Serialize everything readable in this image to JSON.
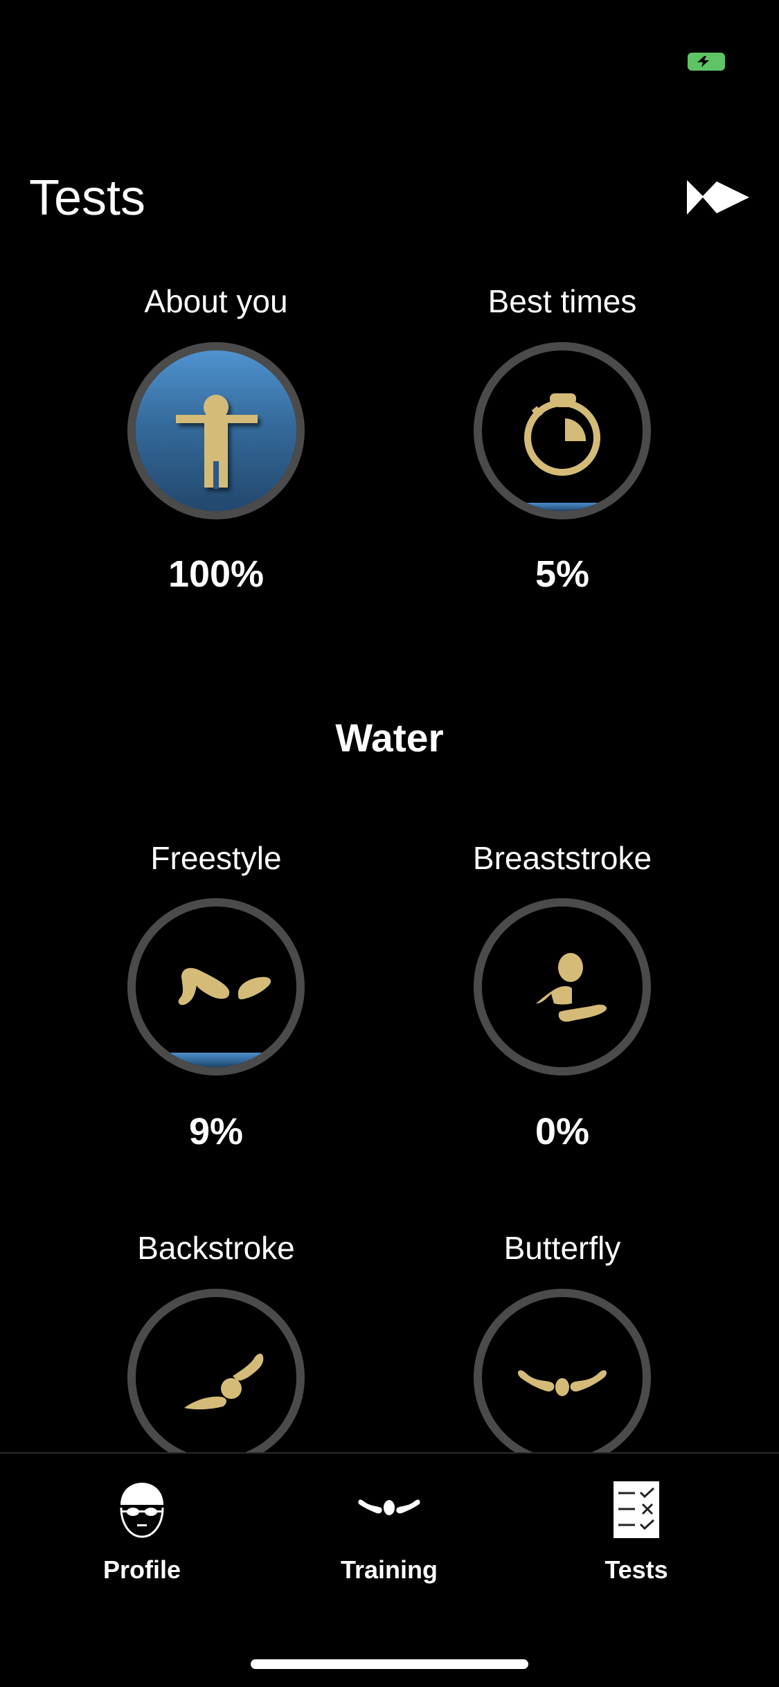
{
  "status_bar": {
    "battery_icon": "battery-charging-icon",
    "battery_color": "#5fc465"
  },
  "header": {
    "title": "Tests",
    "action_icon": "fish-logo-icon"
  },
  "top_tests": [
    {
      "label": "About you",
      "icon": "person-icon",
      "progress_percent": 100,
      "percent_text": "100%"
    },
    {
      "label": "Best times",
      "icon": "stopwatch-icon",
      "progress_percent": 5,
      "percent_text": "5%"
    }
  ],
  "water_section": {
    "title": "Water",
    "tests": [
      {
        "label": "Freestyle",
        "icon": "freestyle-swimmer-icon",
        "progress_percent": 9,
        "percent_text": "9%"
      },
      {
        "label": "Breaststroke",
        "icon": "breaststroke-swimmer-icon",
        "progress_percent": 0,
        "percent_text": "0%"
      },
      {
        "label": "Backstroke",
        "icon": "backstroke-swimmer-icon"
      },
      {
        "label": "Butterfly",
        "icon": "butterfly-swimmer-icon"
      }
    ]
  },
  "tab_bar": {
    "items": [
      {
        "label": "Profile",
        "icon": "swimmer-cap-goggles-icon",
        "selected": false
      },
      {
        "label": "Training",
        "icon": "butterfly-swimmer-icon",
        "selected": false
      },
      {
        "label": "Tests",
        "icon": "checklist-icon",
        "selected": true
      }
    ]
  },
  "colors": {
    "background": "#000000",
    "ring": "#4b4b4b",
    "progress_fill": "#3f7fba",
    "icon_gold": "#d4bb78",
    "text": "#ffffff"
  }
}
